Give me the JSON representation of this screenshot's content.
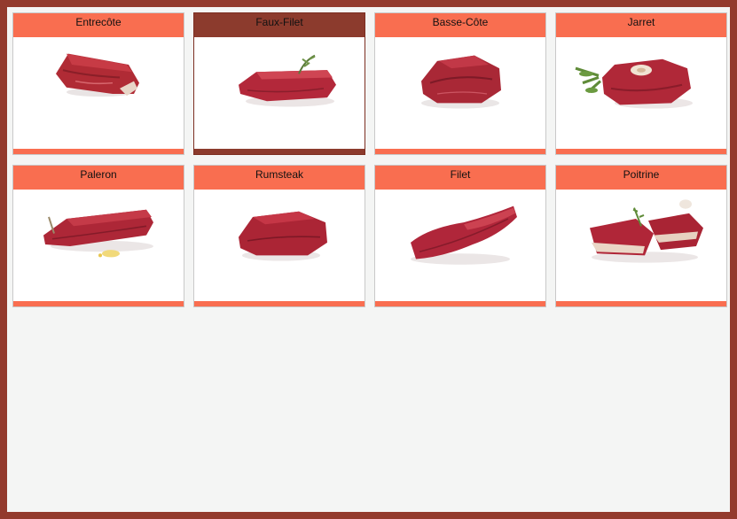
{
  "window": {
    "accent_color": "#f96e50",
    "selected_color": "#8c3b2d",
    "frame_color": "#933a2d"
  },
  "cuts": [
    {
      "label": "Entrecôte",
      "image": "entrecote-meat-image",
      "selected": false
    },
    {
      "label": "Faux-Filet",
      "image": "faux-filet-meat-image",
      "selected": true
    },
    {
      "label": "Basse-Côte",
      "image": "basse-cote-meat-image",
      "selected": false
    },
    {
      "label": "Jarret",
      "image": "jarret-meat-image",
      "selected": false
    },
    {
      "label": "Paleron",
      "image": "paleron-meat-image",
      "selected": false
    },
    {
      "label": "Rumsteak",
      "image": "rumsteak-meat-image",
      "selected": false
    },
    {
      "label": "Filet",
      "image": "filet-meat-image",
      "selected": false
    },
    {
      "label": "Poitrine",
      "image": "poitrine-meat-image",
      "selected": false
    }
  ]
}
